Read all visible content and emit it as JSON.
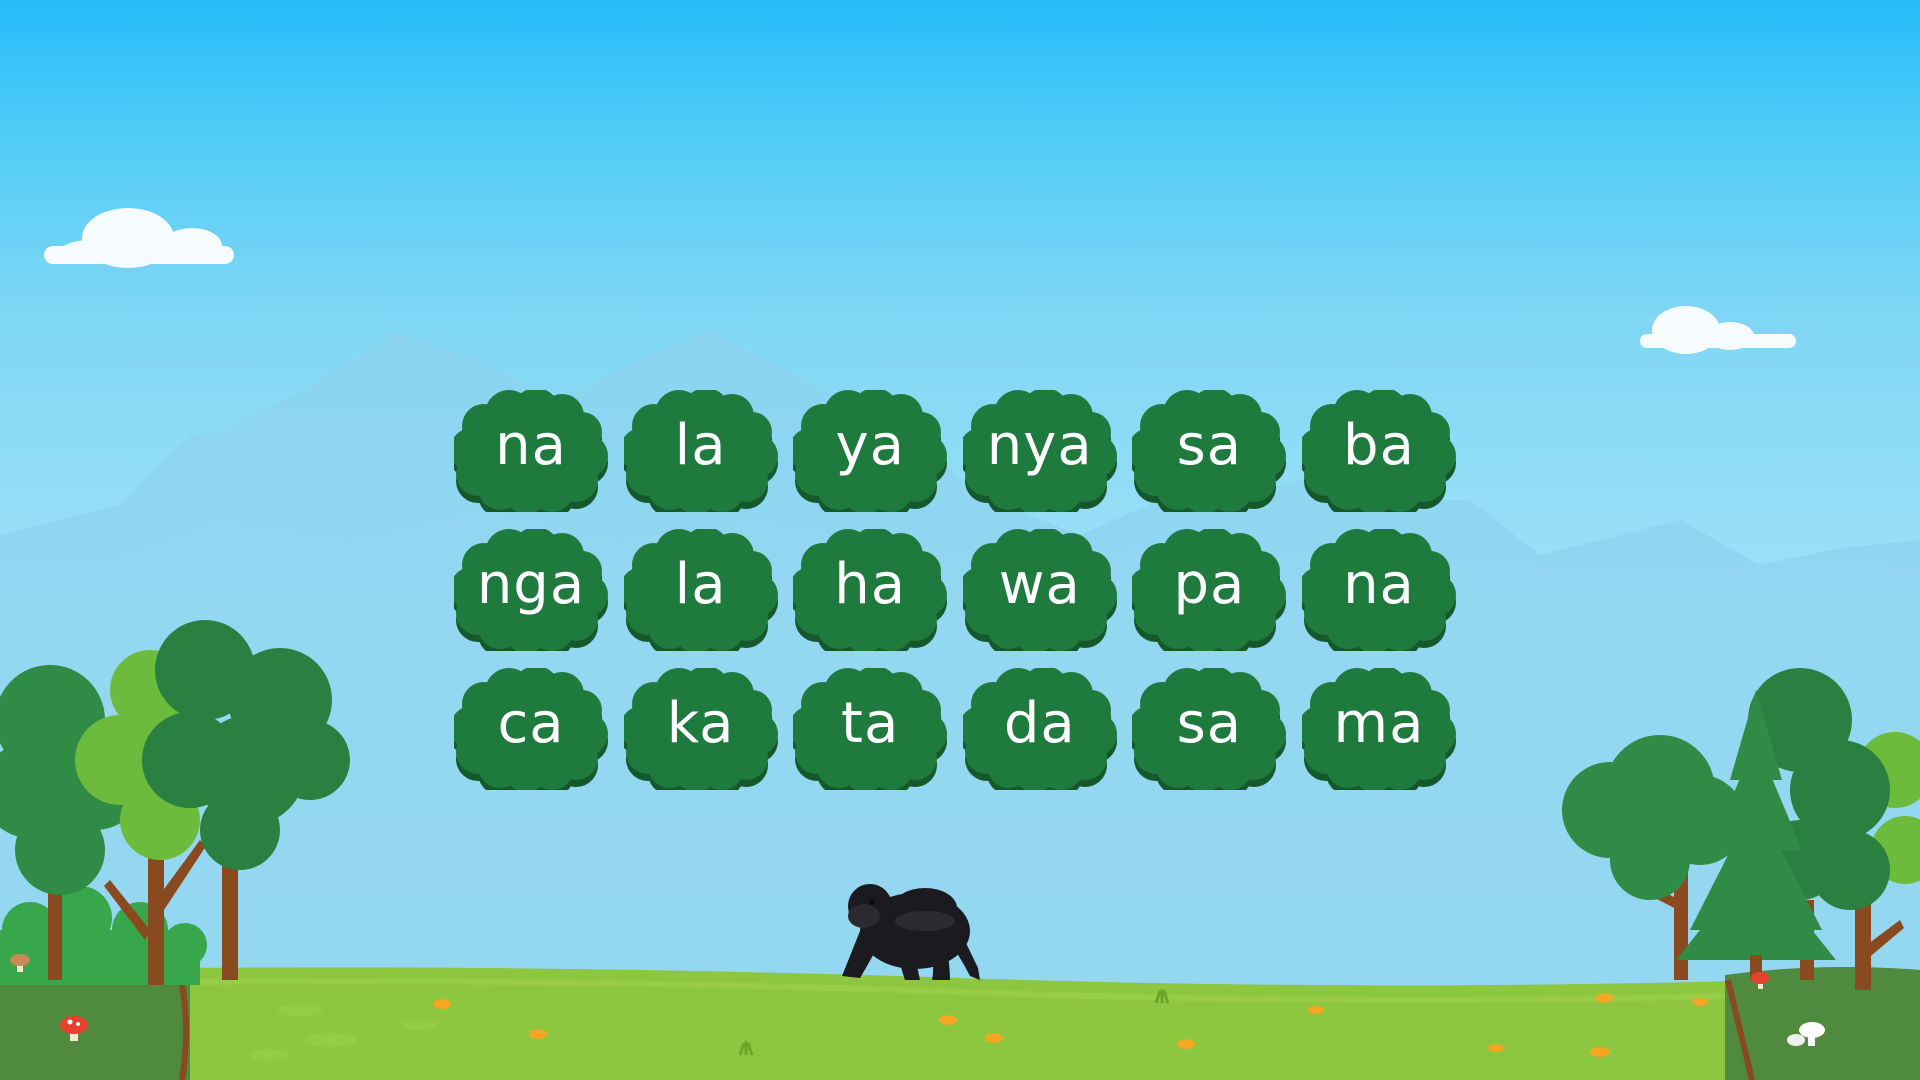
{
  "game": {
    "syllables": [
      "na",
      "la",
      "ya",
      "nya",
      "sa",
      "ba",
      "nga",
      "la",
      "ha",
      "wa",
      "pa",
      "na",
      "ca",
      "ka",
      "ta",
      "da",
      "sa",
      "ma"
    ]
  },
  "colors": {
    "tile": "#1f7a3d",
    "tile_edge": "#14582b",
    "tile_text": "#ffffff",
    "grass": "#8dc63f",
    "sky_top": "#24bcf8"
  },
  "icons": {
    "tile_shape": "bush-icon",
    "character": "gorilla-icon"
  }
}
